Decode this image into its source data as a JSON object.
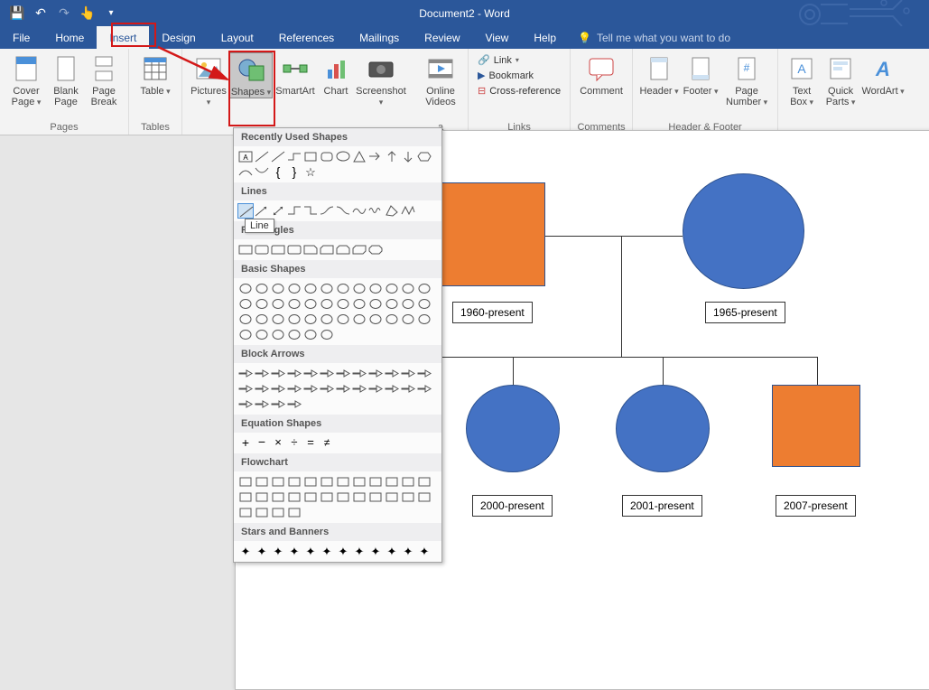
{
  "title": "Document2 - Word",
  "qat": {
    "save": "save",
    "undo": "undo",
    "redo": "redo",
    "touch": "touch",
    "more": "more"
  },
  "tabs": [
    "File",
    "Home",
    "Insert",
    "Design",
    "Layout",
    "References",
    "Mailings",
    "Review",
    "View",
    "Help"
  ],
  "active_tab": "Insert",
  "tell_me": "Tell me what you want to do",
  "ribbon": {
    "pages": {
      "label": "Pages",
      "cover": "Cover Page",
      "blank": "Blank Page",
      "break": "Page Break"
    },
    "tables": {
      "label": "Tables",
      "table": "Table"
    },
    "illustrations": {
      "pictures": "Pictures",
      "shapes": "Shapes",
      "smartart": "SmartArt",
      "chart": "Chart",
      "screenshot": "Screenshot"
    },
    "media": {
      "online": "Online Videos"
    },
    "links": {
      "label": "Links",
      "link": "Link",
      "bookmark": "Bookmark",
      "crossref": "Cross-reference"
    },
    "comments": {
      "label": "Comments",
      "comment": "Comment"
    },
    "headerfooter": {
      "label": "Header & Footer",
      "header": "Header",
      "footer": "Footer",
      "pagenum": "Page Number"
    },
    "text": {
      "textbox": "Text Box",
      "quickparts": "Quick Parts",
      "wordart": "WordArt"
    }
  },
  "shapes_menu": {
    "recent": "Recently Used Shapes",
    "lines": "Lines",
    "rectangles": "Rectangles",
    "basic": "Basic Shapes",
    "arrows": "Block Arrows",
    "equation": "Equation Shapes",
    "flowchart": "Flowchart",
    "stars": "Stars and Banners",
    "tooltip": "Line"
  },
  "canvas": {
    "label1": "1960-present",
    "label2": "1965-present",
    "label3": "2000-present",
    "label4": "2001-present",
    "label5": "2007-present"
  },
  "colors": {
    "ribbon_blue": "#2b579a",
    "accent_orange": "#ed7d31",
    "accent_blue": "#4472c4"
  }
}
